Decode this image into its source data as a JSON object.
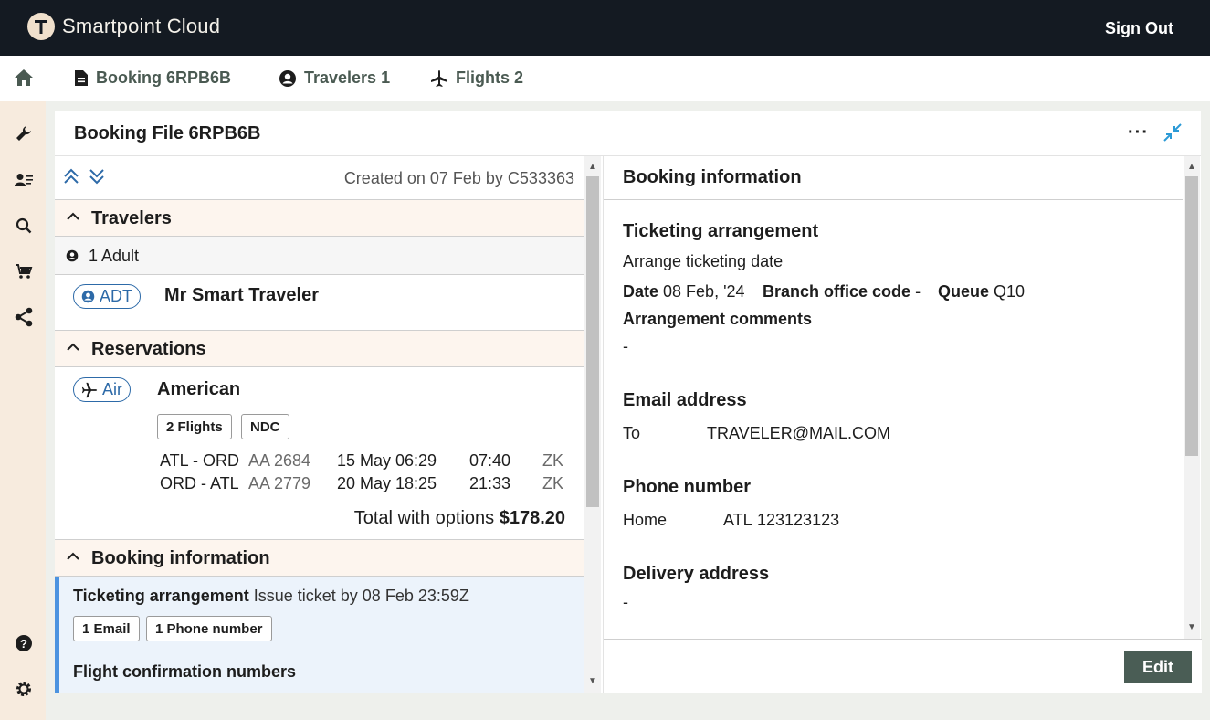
{
  "app": {
    "title": "Smartpoint Cloud",
    "sign_out": "Sign Out"
  },
  "nav": {
    "booking": "Booking 6RPB6B",
    "travelers": "Travelers 1",
    "flights": "Flights 2"
  },
  "card": {
    "title": "Booking File 6RPB6B",
    "more": "···"
  },
  "left": {
    "created": "Created on 07 Feb by C533363",
    "travelers_header": "Travelers",
    "adult_count": "1 Adult",
    "traveler_type": "ADT",
    "traveler_name": "Mr Smart Traveler",
    "reservations_header": "Reservations",
    "res_type": "Air",
    "airline": "American",
    "tags": [
      "2 Flights",
      "NDC"
    ],
    "flights": [
      {
        "route": "ATL - ORD",
        "number": "AA 2684",
        "depart": "15 May 06:29",
        "arrive": "07:40",
        "class": "ZK"
      },
      {
        "route": "ORD - ATL",
        "number": "AA 2779",
        "depart": "20 May 18:25",
        "arrive": "21:33",
        "class": "ZK"
      }
    ],
    "total_label": "Total with options",
    "total_value": "$178.20",
    "booking_info_header": "Booking information",
    "ticketing_label": "Ticketing arrangement",
    "ticketing_value": "Issue ticket by 08 Feb 23:59Z",
    "contact_tags": [
      "1 Email",
      "1 Phone number"
    ],
    "confirmation_header": "Flight confirmation numbers"
  },
  "right": {
    "title": "Booking information",
    "ticketing_header": "Ticketing arrangement",
    "ticketing_sub": "Arrange ticketing date",
    "date_label": "Date",
    "date_value": "08 Feb, '24",
    "branch_label": "Branch office code",
    "branch_value": "-",
    "queue_label": "Queue",
    "queue_value": "Q10",
    "comments_label": "Arrangement comments",
    "comments_value": "-",
    "email_header": "Email address",
    "email_type": "To",
    "email_value": "TRAVELER@MAIL.COM",
    "phone_header": "Phone number",
    "phone_type": "Home",
    "phone_city": "ATL",
    "phone_value": "123123123",
    "delivery_header": "Delivery address",
    "delivery_value": "-",
    "edit": "Edit"
  },
  "colors": {
    "accent": "#2d6aa8",
    "dark": "#141a22",
    "sidebar": "#f7ebde",
    "button": "#4a5d55"
  }
}
